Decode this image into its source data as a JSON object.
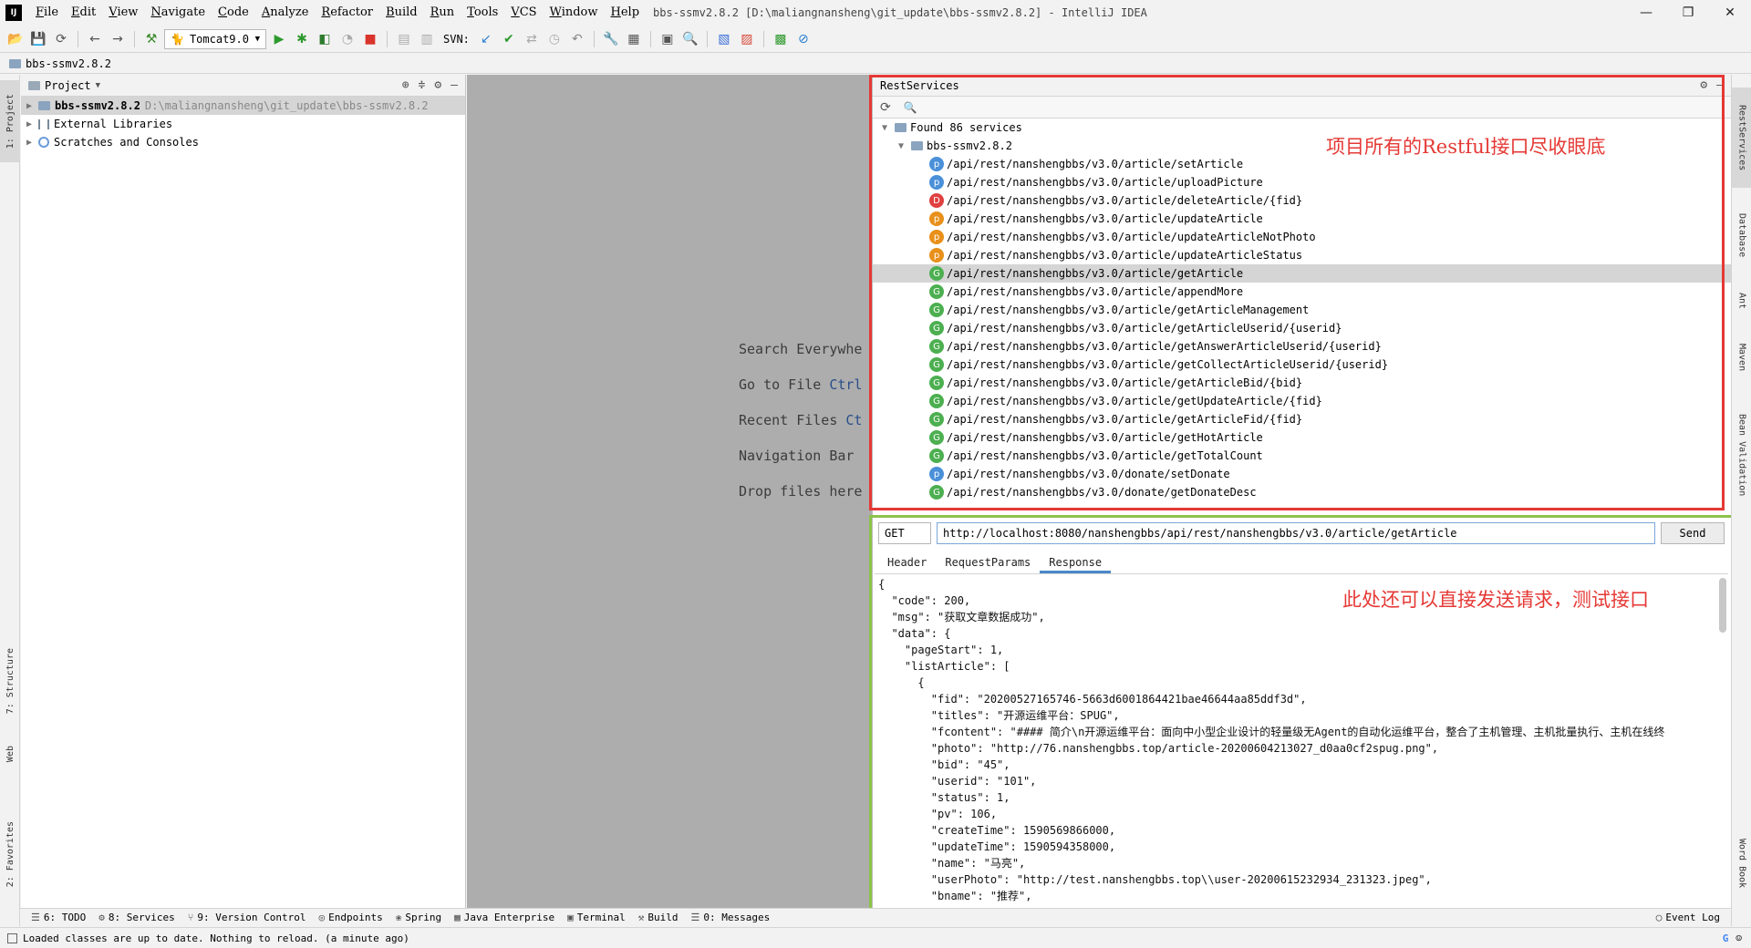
{
  "window": {
    "title": "bbs-ssmv2.8.2 [D:\\maliangnansheng\\git_update\\bbs-ssmv2.8.2] - IntelliJ IDEA",
    "logo": "IJ",
    "minimize": "—",
    "maximize": "❐",
    "close": "✕"
  },
  "menu": [
    "File",
    "Edit",
    "View",
    "Navigate",
    "Code",
    "Analyze",
    "Refactor",
    "Build",
    "Run",
    "Tools",
    "VCS",
    "Window",
    "Help"
  ],
  "toolbar": {
    "run_config": "Tomcat9.0",
    "svn_label": "SVN:"
  },
  "breadcrumb": "bbs-ssmv2.8.2",
  "left_stripe": {
    "project": "1: Project",
    "structure": "7: Structure",
    "web": "Web",
    "favorites": "2: Favorites"
  },
  "right_stripe": {
    "rest": "RestServices",
    "database": "Database",
    "ant": "Ant",
    "maven": "Maven",
    "bean": "Bean Validation",
    "word": "Word Book"
  },
  "project_panel": {
    "title": "Project",
    "items": [
      {
        "label": "bbs-ssmv2.8.2",
        "path": "D:\\maliangnansheng\\git_update\\bbs-ssmv2.8.2"
      },
      {
        "label": "External Libraries",
        "path": ""
      },
      {
        "label": "Scratches and Consoles",
        "path": ""
      }
    ]
  },
  "editor_hints": [
    {
      "label": "Search Everywhe",
      "key": ""
    },
    {
      "label": "Go to File ",
      "key": "Ctrl"
    },
    {
      "label": "Recent Files ",
      "key": "Ct"
    },
    {
      "label": "Navigation Bar",
      "key": ""
    },
    {
      "label": "Drop files here",
      "key": ""
    }
  ],
  "rest_panel": {
    "title": "RestServices",
    "found": "Found 86 services",
    "module": "bbs-ssmv2.8.2",
    "services": [
      {
        "m": "p",
        "path": "/api/rest/nanshengbbs/v3.0/article/setArticle"
      },
      {
        "m": "p",
        "path": "/api/rest/nanshengbbs/v3.0/article/uploadPicture"
      },
      {
        "m": "d",
        "path": "/api/rest/nanshengbbs/v3.0/article/deleteArticle/{fid}"
      },
      {
        "m": "u",
        "path": "/api/rest/nanshengbbs/v3.0/article/updateArticle"
      },
      {
        "m": "u",
        "path": "/api/rest/nanshengbbs/v3.0/article/updateArticleNotPhoto"
      },
      {
        "m": "u",
        "path": "/api/rest/nanshengbbs/v3.0/article/updateArticleStatus"
      },
      {
        "m": "g",
        "path": "/api/rest/nanshengbbs/v3.0/article/getArticle"
      },
      {
        "m": "g",
        "path": "/api/rest/nanshengbbs/v3.0/article/appendMore"
      },
      {
        "m": "g",
        "path": "/api/rest/nanshengbbs/v3.0/article/getArticleManagement"
      },
      {
        "m": "g",
        "path": "/api/rest/nanshengbbs/v3.0/article/getArticleUserid/{userid}"
      },
      {
        "m": "g",
        "path": "/api/rest/nanshengbbs/v3.0/article/getAnswerArticleUserid/{userid}"
      },
      {
        "m": "g",
        "path": "/api/rest/nanshengbbs/v3.0/article/getCollectArticleUserid/{userid}"
      },
      {
        "m": "g",
        "path": "/api/rest/nanshengbbs/v3.0/article/getArticleBid/{bid}"
      },
      {
        "m": "g",
        "path": "/api/rest/nanshengbbs/v3.0/article/getUpdateArticle/{fid}"
      },
      {
        "m": "g",
        "path": "/api/rest/nanshengbbs/v3.0/article/getArticleFid/{fid}"
      },
      {
        "m": "g",
        "path": "/api/rest/nanshengbbs/v3.0/article/getHotArticle"
      },
      {
        "m": "g",
        "path": "/api/rest/nanshengbbs/v3.0/article/getTotalCount"
      },
      {
        "m": "p",
        "path": "/api/rest/nanshengbbs/v3.0/donate/setDonate"
      },
      {
        "m": "g",
        "path": "/api/rest/nanshengbbs/v3.0/donate/getDonateDesc"
      }
    ],
    "method_letters": {
      "p": "p",
      "d": "D",
      "u": "p",
      "g": "G"
    },
    "request": {
      "method": "GET",
      "url": "http://localhost:8080/nanshengbbs/api/rest/nanshengbbs/v3.0/article/getArticle",
      "send": "Send"
    },
    "tabs": [
      "Header",
      "RequestParams",
      "Response"
    ],
    "response_lines": [
      "{",
      "  \"code\": 200,",
      "  \"msg\": \"获取文章数据成功\",",
      "  \"data\": {",
      "    \"pageStart\": 1,",
      "    \"listArticle\": [",
      "      {",
      "        \"fid\": \"20200527165746-5663d6001864421bae46644aa85ddf3d\",",
      "        \"titles\": \"开源运维平台：SPUG\",",
      "        \"fcontent\": \"#### 简介\\n开源运维平台：面向中小型企业设计的轻量级无Agent的自动化运维平台，整合了主机管理、主机批量执行、主机在线终",
      "        \"photo\": \"http://76.nanshengbbs.top/article-20200604213027_d0aa0cf2spug.png\",",
      "        \"bid\": \"45\",",
      "        \"userid\": \"101\",",
      "        \"status\": 1,",
      "        \"pv\": 106,",
      "        \"createTime\": 1590569866000,",
      "        \"updateTime\": 1590594358000,",
      "        \"name\": \"马亮\",",
      "        \"userPhoto\": \"http://test.nanshengbbs.top\\\\user-20200615232934_231323.jpeg\",",
      "        \"bname\": \"推荐\","
    ]
  },
  "annotations": {
    "top": "项目所有的Restful接口尽收眼底",
    "bottom": "此处还可以直接发送请求，测试接口"
  },
  "bottom_tabs": [
    {
      "icon": "☰",
      "label": "6: TODO"
    },
    {
      "icon": "⚙",
      "label": "8: Services"
    },
    {
      "icon": "⑂",
      "label": "9: Version Control"
    },
    {
      "icon": "◎",
      "label": "Endpoints"
    },
    {
      "icon": "❀",
      "label": "Spring"
    },
    {
      "icon": "▦",
      "label": "Java Enterprise"
    },
    {
      "icon": "▣",
      "label": "Terminal"
    },
    {
      "icon": "⚒",
      "label": "Build"
    },
    {
      "icon": "☰",
      "label": "0: Messages"
    }
  ],
  "event_log": "Event Log",
  "status": "Loaded classes are up to date. Nothing to reload. (a minute ago)"
}
